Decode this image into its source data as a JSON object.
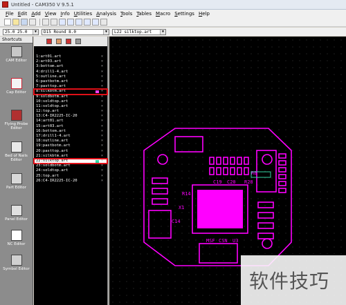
{
  "window": {
    "title": "Untitled - CAM350 V 9.5.1"
  },
  "menu": [
    "File",
    "Edit",
    "Add",
    "View",
    "Info",
    "Utilities",
    "Analysis",
    "Tools",
    "Tables",
    "Macro",
    "Settings",
    "Help"
  ],
  "selectors": {
    "grid": "25.0 25.0",
    "aperture": "D15  Round 8.0",
    "layer": "L22 silktop.art"
  },
  "shortcuts": {
    "title": "Shortcuts",
    "items": [
      "CAM Editor",
      "Cap Editor",
      "Flying Probe Editor",
      "Bed of Nails Editor",
      "Part Editor",
      "Panel Editor",
      "NC Editor",
      "Symbol Editor"
    ]
  },
  "layers": [
    "1:art01.art",
    "2:art03.art",
    "3:bottom.art",
    "4:drill1-4.art",
    "5:outline.art",
    "6:pastbotm.art",
    "7:pasttop.art",
    "8:silkbtm.art",
    "9:soldbotm.art",
    "10:soldtop.art",
    "11:soldtop.art",
    "12:top.art",
    "13:C4-IR2225-IC-20",
    "14:art01.art",
    "15:art03.art",
    "16:bottom.art",
    "17:drill1-4.art",
    "18:outline.art",
    "19:pastbotm.art",
    "20:pasttop.art",
    "21:silkbtm.art",
    "22:silktop.art",
    "23:soldbotm.art",
    "24:soldtop.art",
    "25:top.art",
    "26:C4-IR2225-IC-20"
  ],
  "board_labels": [
    "MSF",
    "CSN",
    "U3",
    "X1",
    "C14",
    "R14",
    "C19",
    "C20",
    "R28",
    "RB"
  ],
  "watermark": "软件技巧",
  "colors": {
    "board": "#ff00ff",
    "background": "#000000",
    "highlight": "#e01018"
  }
}
